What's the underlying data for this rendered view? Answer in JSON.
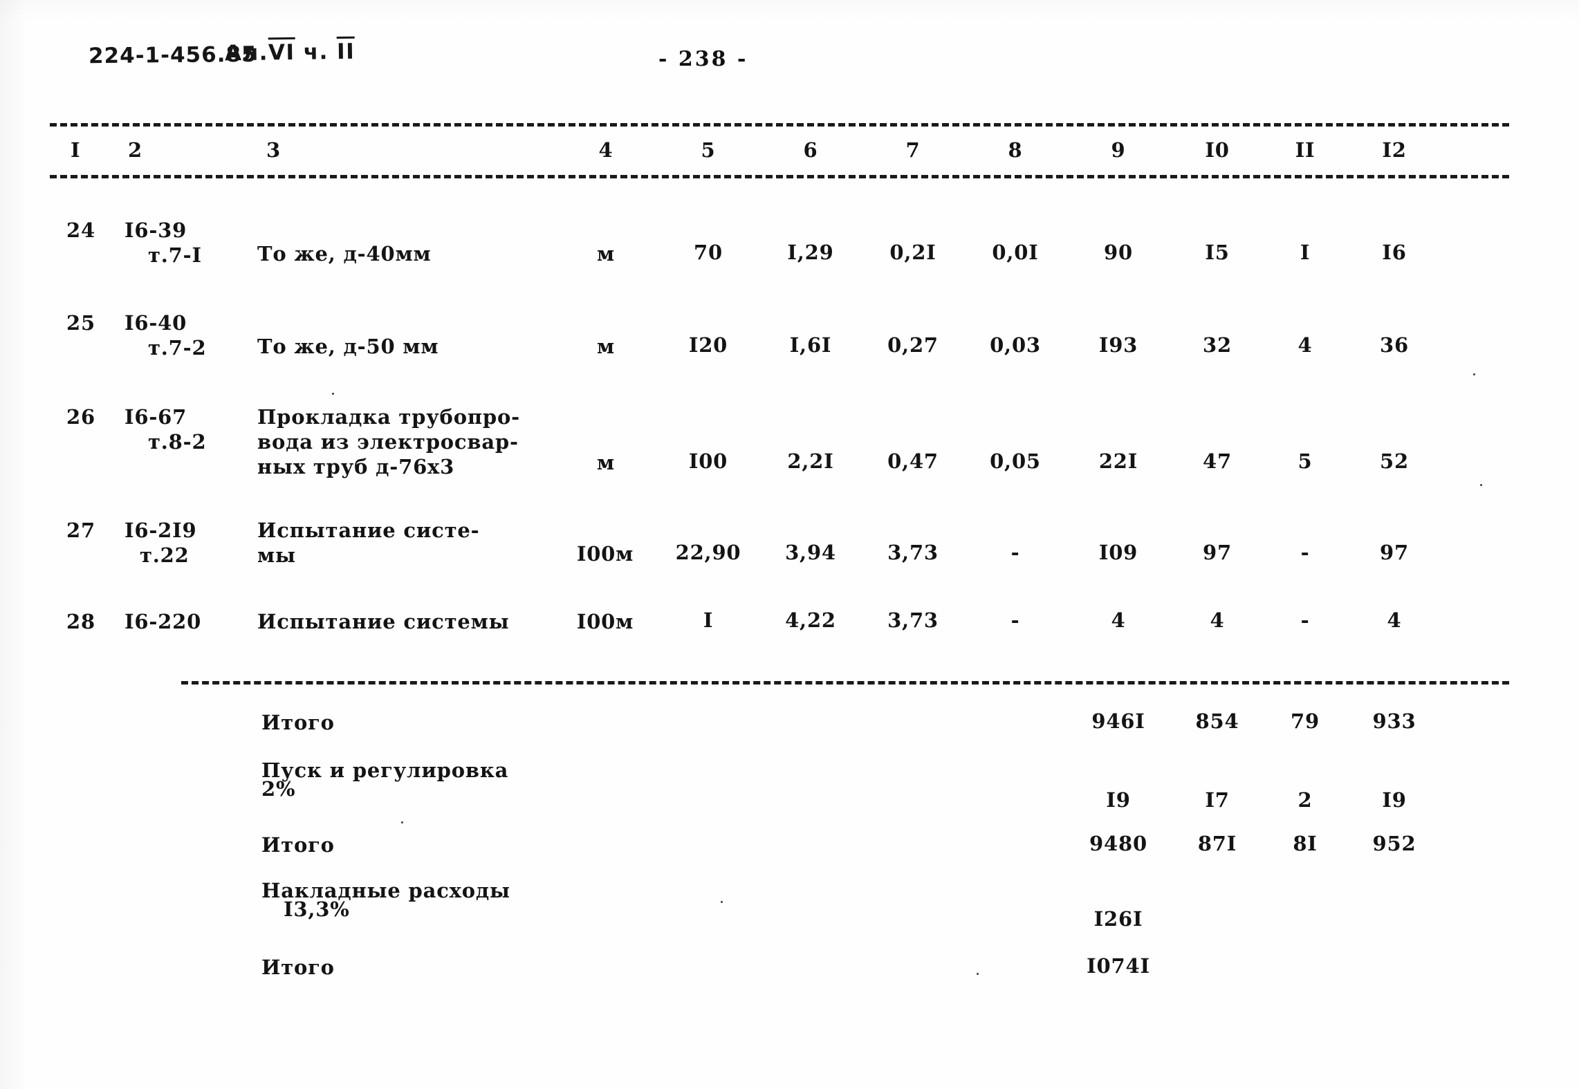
{
  "header": {
    "doc_code": "224-1-456.85",
    "album_prefix": "Ал.",
    "album_roman": "VI",
    "part_prefix": "ч.",
    "part_roman": "II",
    "page_number": "- 238 -"
  },
  "table": {
    "column_headers": [
      "I",
      "2",
      "3",
      "4",
      "5",
      "6",
      "7",
      "8",
      "9",
      "I0",
      "II",
      "I2"
    ],
    "rows": [
      {
        "no": "24",
        "code_line1": "I6-39",
        "code_line2": "т.7-I",
        "desc_line1": "То же, д-40мм",
        "desc_line2": "",
        "desc_line3": "",
        "unit": "м",
        "c5": "70",
        "c6": "I,29",
        "c7": "0,2I",
        "c8": "0,0I",
        "c9": "90",
        "c10": "I5",
        "c11": "I",
        "c12": "I6"
      },
      {
        "no": "25",
        "code_line1": "I6-40",
        "code_line2": "т.7-2",
        "desc_line1": "То же, д-50 мм",
        "desc_line2": "",
        "desc_line3": "",
        "unit": "м",
        "c5": "I20",
        "c6": "I,6I",
        "c7": "0,27",
        "c8": "0,03",
        "c9": "I93",
        "c10": "32",
        "c11": "4",
        "c12": "36"
      },
      {
        "no": "26",
        "code_line1": "I6-67",
        "code_line2": "т.8-2",
        "desc_line1": "Прокладка трубопро-",
        "desc_line2": "вода из электросвар-",
        "desc_line3": "ных труб д-76х3",
        "unit": "м",
        "c5": "I00",
        "c6": "2,2I",
        "c7": "0,47",
        "c8": "0,05",
        "c9": "22I",
        "c10": "47",
        "c11": "5",
        "c12": "52"
      },
      {
        "no": "27",
        "code_line1": "I6-2I9",
        "code_line2": "т.22",
        "desc_line1": "Испытание систе-",
        "desc_line2": "мы",
        "desc_line3": "",
        "unit": "I00м",
        "c5": "22,90",
        "c6": "3,94",
        "c7": "3,73",
        "c8": "-",
        "c9": "I09",
        "c10": "97",
        "c11": "-",
        "c12": "97"
      },
      {
        "no": "28",
        "code_line1": "I6-220",
        "code_line2": "",
        "desc_line1": "Испытание системы",
        "desc_line2": "",
        "desc_line3": "",
        "unit": "I00м",
        "c5": "I",
        "c6": "4,22",
        "c7": "3,73",
        "c8": "-",
        "c9": "4",
        "c10": "4",
        "c11": "-",
        "c12": "4"
      }
    ],
    "summary": [
      {
        "label_line1": "Итого",
        "label_line2": "",
        "c9": "946I",
        "c10": "854",
        "c11": "79",
        "c12": "933"
      },
      {
        "label_line1": "Пуск и регулировка",
        "label_line2": "2%",
        "c9": "I9",
        "c10": "I7",
        "c11": "2",
        "c12": "I9"
      },
      {
        "label_line1": "Итого",
        "label_line2": "",
        "c9": "9480",
        "c10": "87I",
        "c11": "8I",
        "c12": "952"
      },
      {
        "label_line1": "Накладные расходы",
        "label_line2": "I3,3%",
        "c9": "I26I",
        "c10": "",
        "c11": "",
        "c12": ""
      },
      {
        "label_line1": "Итого",
        "label_line2": "",
        "c9": "I074I",
        "c10": "",
        "c11": "",
        "c12": ""
      }
    ]
  }
}
